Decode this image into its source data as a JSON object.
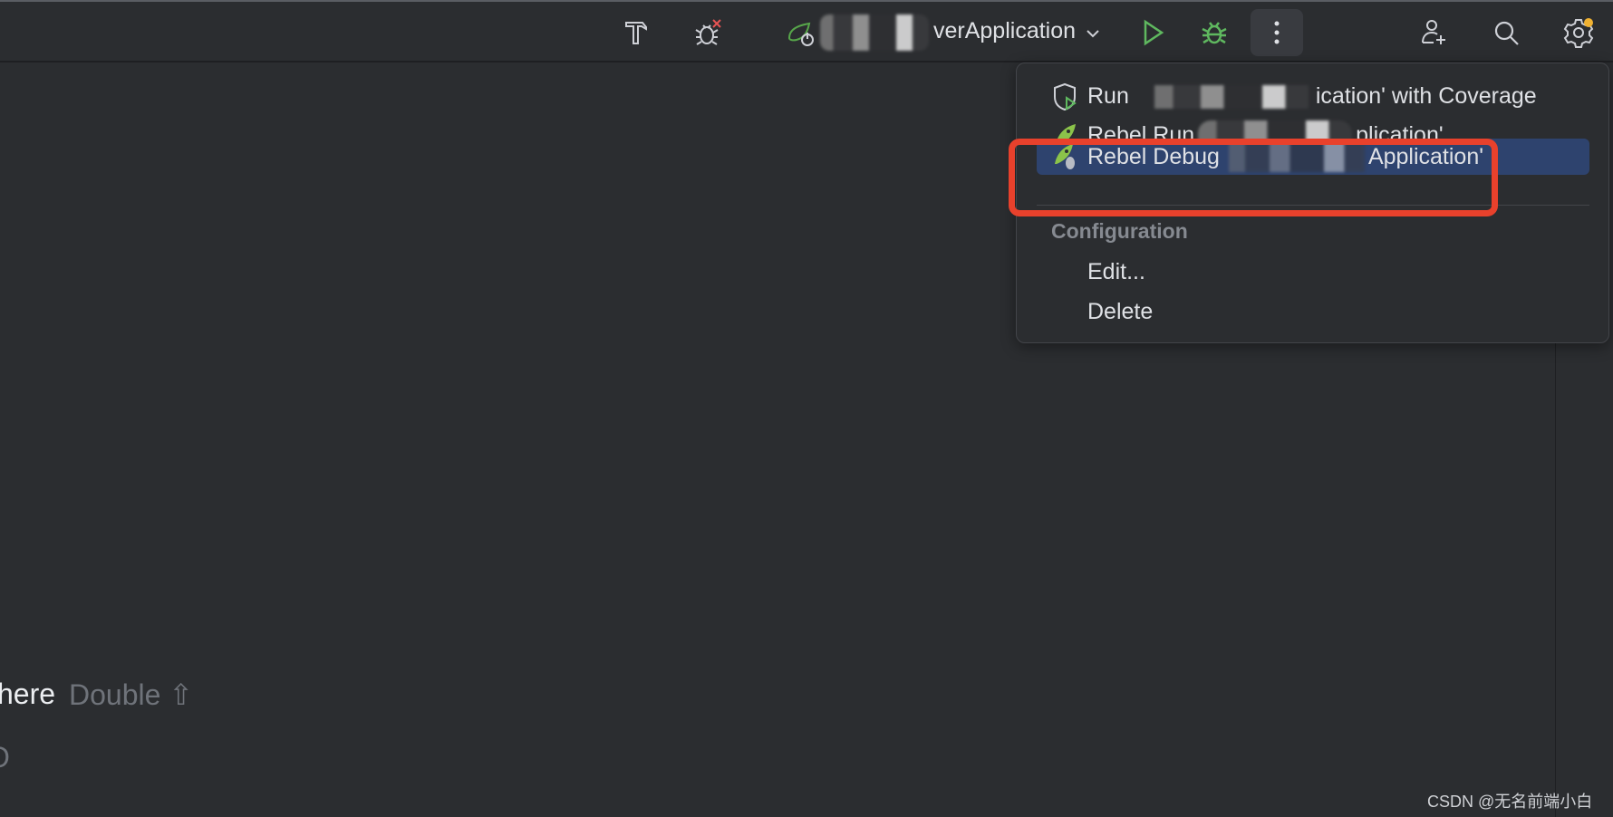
{
  "toolbar": {
    "icons": [
      "hammer-icon",
      "debug-stop-icon",
      "spring-boot-icon",
      "run-icon",
      "debug-icon",
      "more-vertical-icon",
      "add-user-icon",
      "search-icon",
      "settings-icon"
    ],
    "config_name": "verApplication",
    "accent_run": "#5fb85f",
    "notification_dot": "#f0b232"
  },
  "menu": {
    "items": [
      {
        "label_prefix": "Run",
        "label_suffix": "ication' with Coverage",
        "icon": "coverage-icon"
      },
      {
        "label_prefix": "Rebel Run",
        "label_suffix": "plication'",
        "icon": "jrebel-run-icon"
      },
      {
        "label_prefix": "Rebel Debug",
        "label_suffix": "Application'",
        "icon": "jrebel-debug-icon",
        "selected": true
      }
    ],
    "section_label": "Configuration",
    "edit_label": "Edit...",
    "delete_label": "Delete",
    "highlight_color": "#e8412c"
  },
  "editor": {
    "hint_action": "here",
    "hint_shortcut": "Double ⇧",
    "partial_text": "O"
  },
  "watermark": "CSDN @无名前端小白"
}
